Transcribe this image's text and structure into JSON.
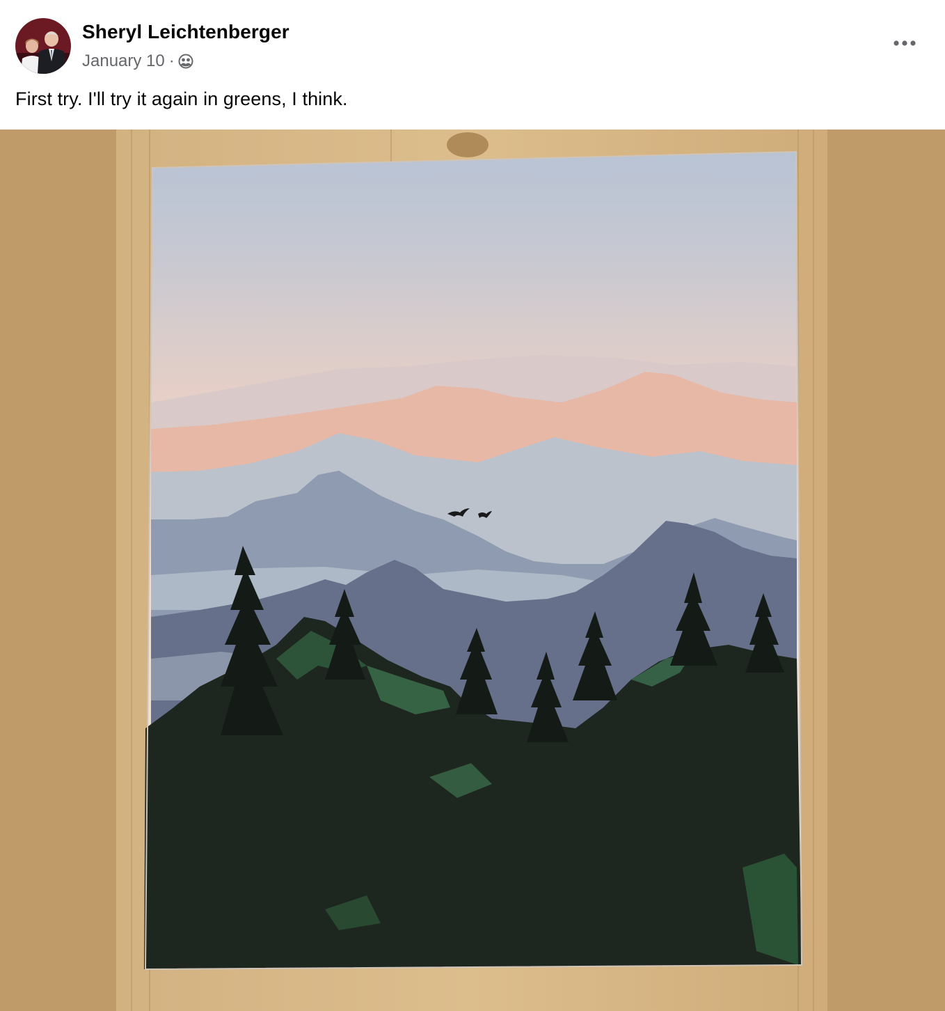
{
  "post": {
    "author_name": "Sheryl Leichtenberger",
    "date": "January 10",
    "separator": "·",
    "audience_icon": "friends-audience-icon",
    "more_icon": "more-options-icon",
    "text": "First try. I'll try it again in greens, I think."
  },
  "media": {
    "background_color": "#be9b68",
    "subject": "painting-photo"
  },
  "colors": {
    "name_text": "#050505",
    "secondary_text": "#65676b"
  }
}
